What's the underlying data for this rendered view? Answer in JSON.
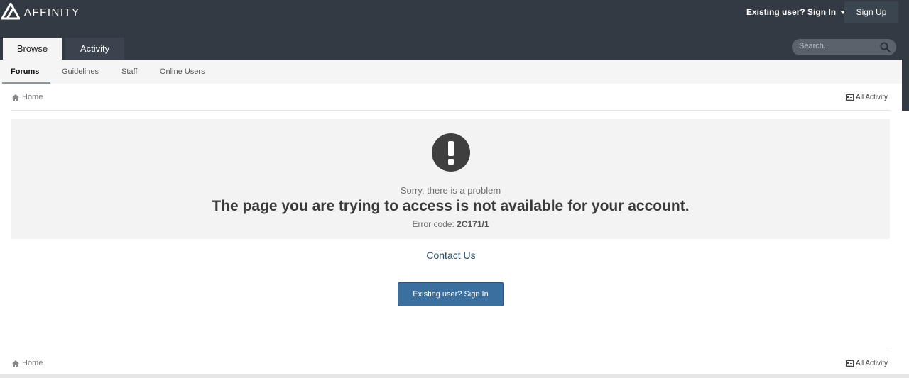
{
  "header": {
    "logo_text": "AFFINITY",
    "user_menu_label": "Existing user? Sign In",
    "signup_label": "Sign Up",
    "tabs": [
      {
        "label": "Browse",
        "active": true
      },
      {
        "label": "Activity",
        "active": false
      }
    ],
    "search_placeholder": "Search..."
  },
  "subnav": {
    "items": [
      {
        "label": "Forums",
        "active": true
      },
      {
        "label": "Guidelines",
        "active": false
      },
      {
        "label": "Staff",
        "active": false
      },
      {
        "label": "Online Users",
        "active": false
      }
    ]
  },
  "breadcrumb": {
    "home_label": "Home",
    "all_activity_label": "All Activity"
  },
  "error": {
    "icon": "exclamation-circle-icon",
    "subtitle": "Sorry, there is a problem",
    "title": "The page you are trying to access is not available for your account.",
    "code_label": "Error code:",
    "code_value": "2C171/1"
  },
  "contact_label": "Contact Us",
  "signin_button_label": "Existing user? Sign In",
  "footer_breadcrumb": {
    "home_label": "Home",
    "all_activity_label": "All Activity"
  },
  "colors": {
    "header_bg": "#333a43",
    "accent_button": "#3a6f9f",
    "link": "#2b4e6e",
    "panel_bg": "#f3f3f3"
  }
}
